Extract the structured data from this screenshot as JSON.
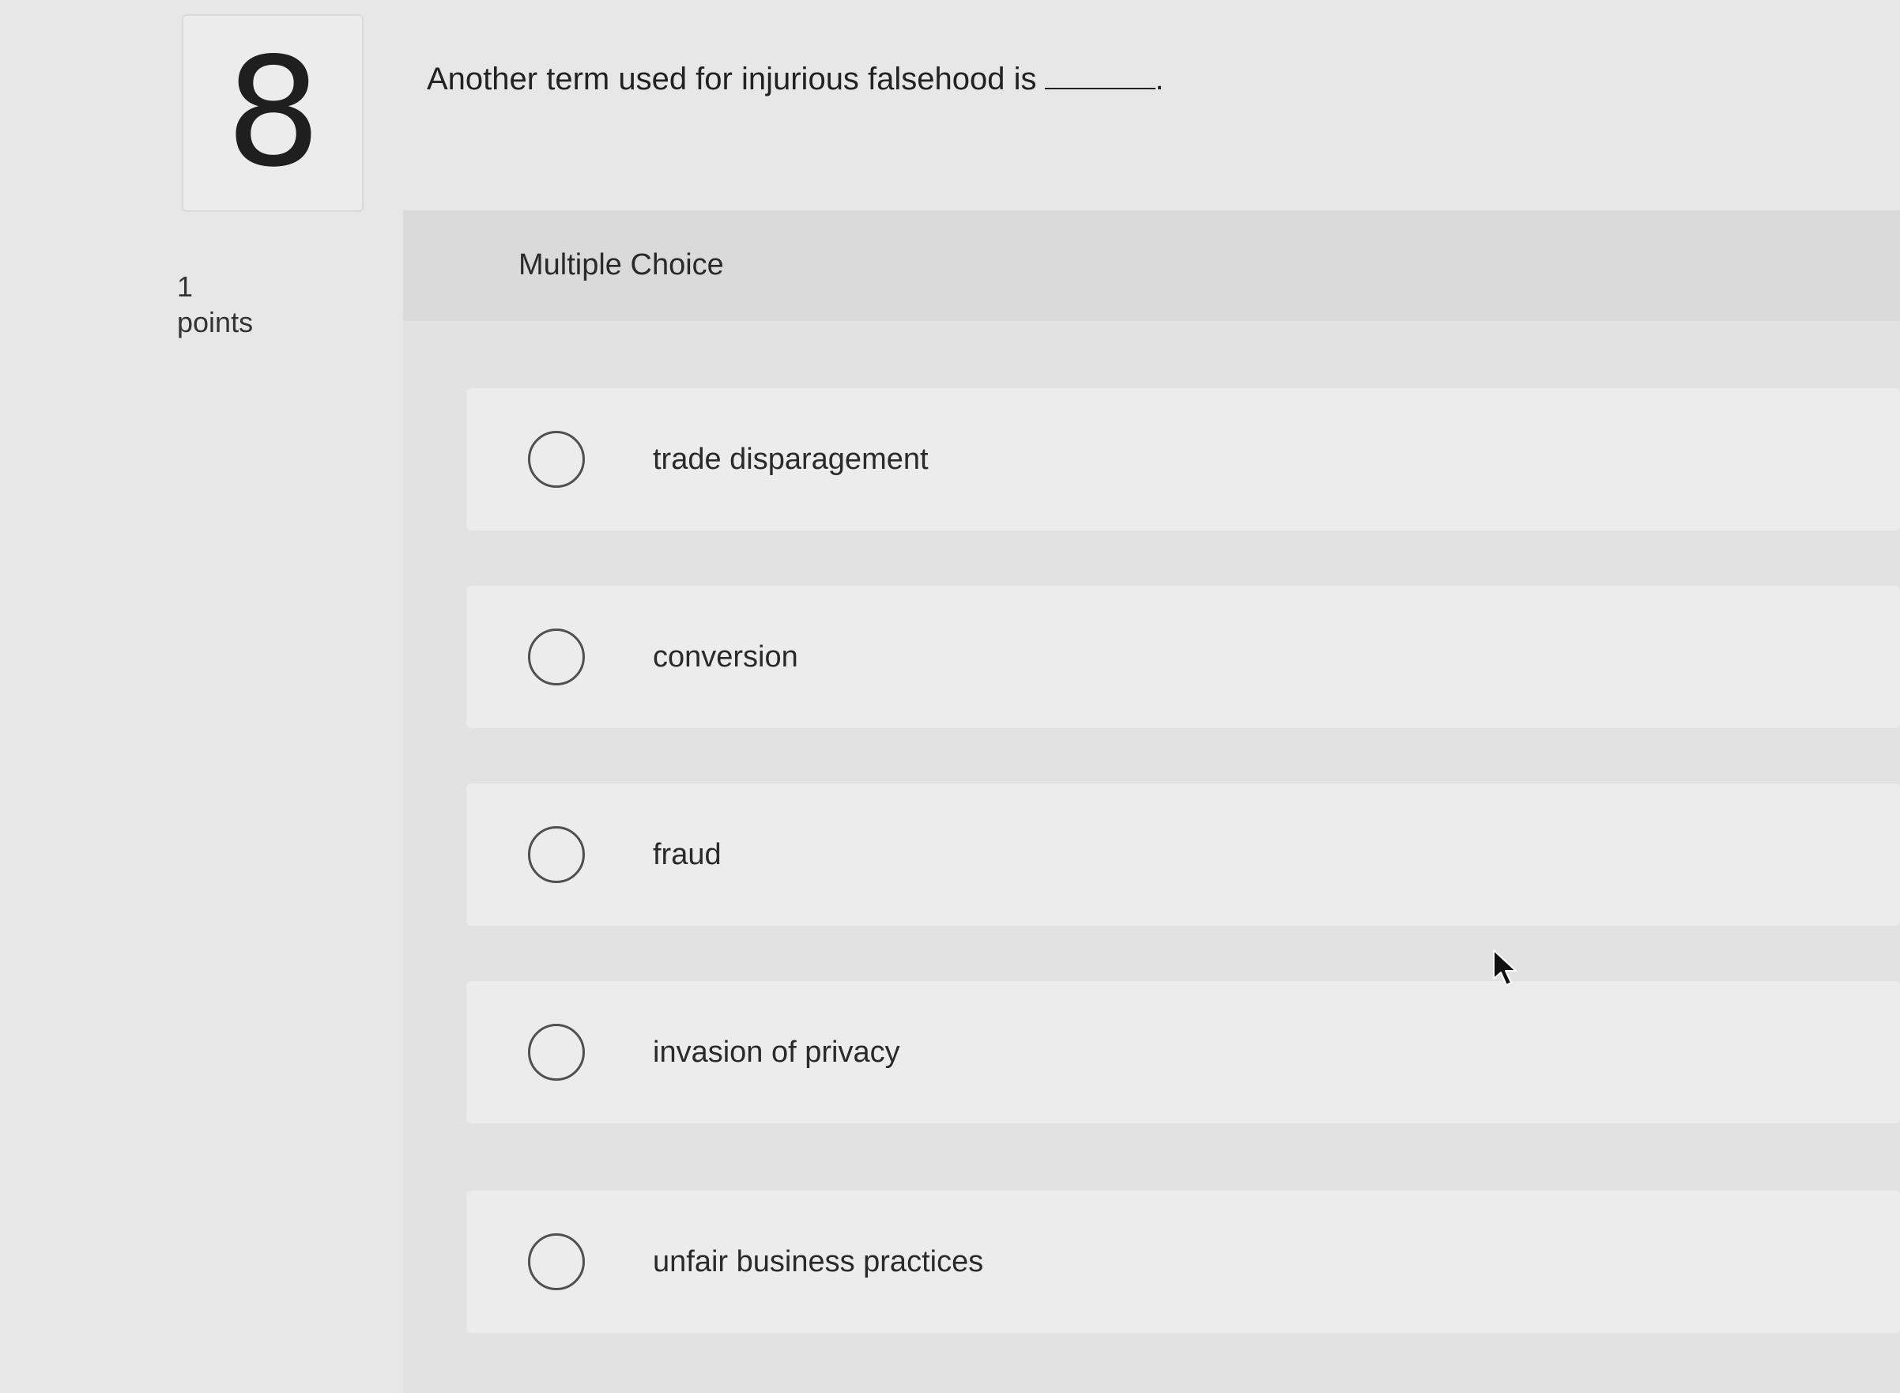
{
  "question": {
    "number": "8",
    "prompt": "Another term used for injurious falsehood is",
    "prompt_end": "."
  },
  "points": {
    "value": "1",
    "label": "points"
  },
  "answer_panel": {
    "type_label": "Multiple Choice",
    "options": [
      {
        "label": "trade disparagement",
        "selected": false
      },
      {
        "label": "conversion",
        "selected": false
      },
      {
        "label": "fraud",
        "selected": false
      },
      {
        "label": "invasion of privacy",
        "selected": false
      },
      {
        "label": "unfair business practices",
        "selected": false
      }
    ]
  },
  "icons": {
    "radio": "radio-unchecked-icon",
    "cursor": "mouse-pointer-icon"
  }
}
